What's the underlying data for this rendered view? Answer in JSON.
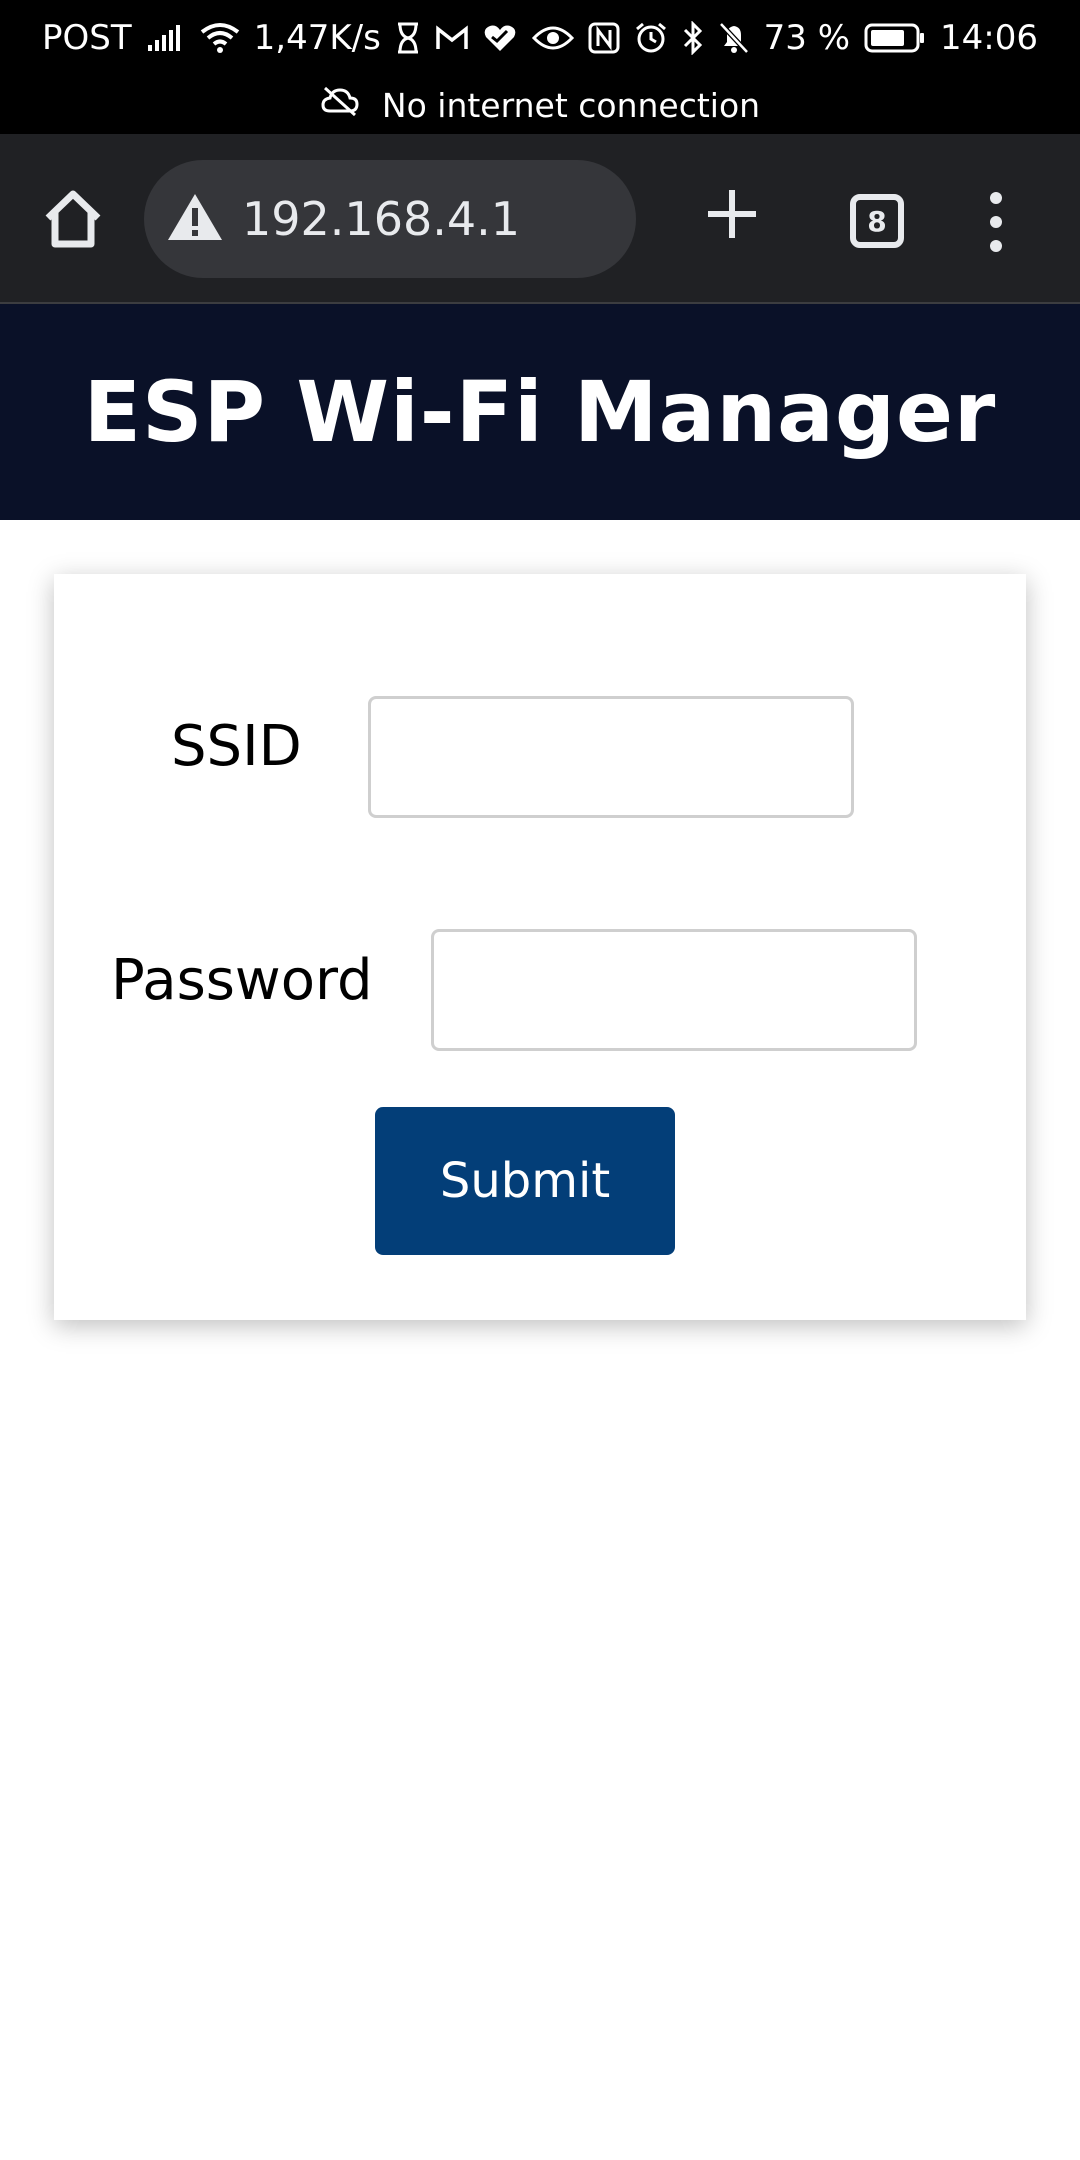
{
  "status_bar": {
    "carrier": "POST",
    "net_speed": "1,47K/s",
    "battery_percent": "73 %",
    "time": "14:06",
    "icons": [
      "signal-icon",
      "wifi-icon",
      "hourglass-icon",
      "gmail-icon",
      "health-icon",
      "eye-icon",
      "nfc-icon",
      "alarm-icon",
      "bluetooth-icon",
      "bell-off-icon",
      "battery-icon"
    ]
  },
  "banner": {
    "text": "No internet connection",
    "icon": "cloud-off-icon"
  },
  "browser": {
    "url": "192.168.4.1",
    "tab_count": "8",
    "icons": [
      "home-icon",
      "warning-icon",
      "plus-icon",
      "tabs-icon",
      "more-vert-icon"
    ]
  },
  "page": {
    "title": "ESP Wi-Fi Manager",
    "header_color": "#0a1128"
  },
  "form": {
    "ssid_label": "SSID",
    "ssid_value": "",
    "password_label": "Password",
    "password_value": "",
    "submit_label": "Submit",
    "button_color": "#033e78"
  }
}
